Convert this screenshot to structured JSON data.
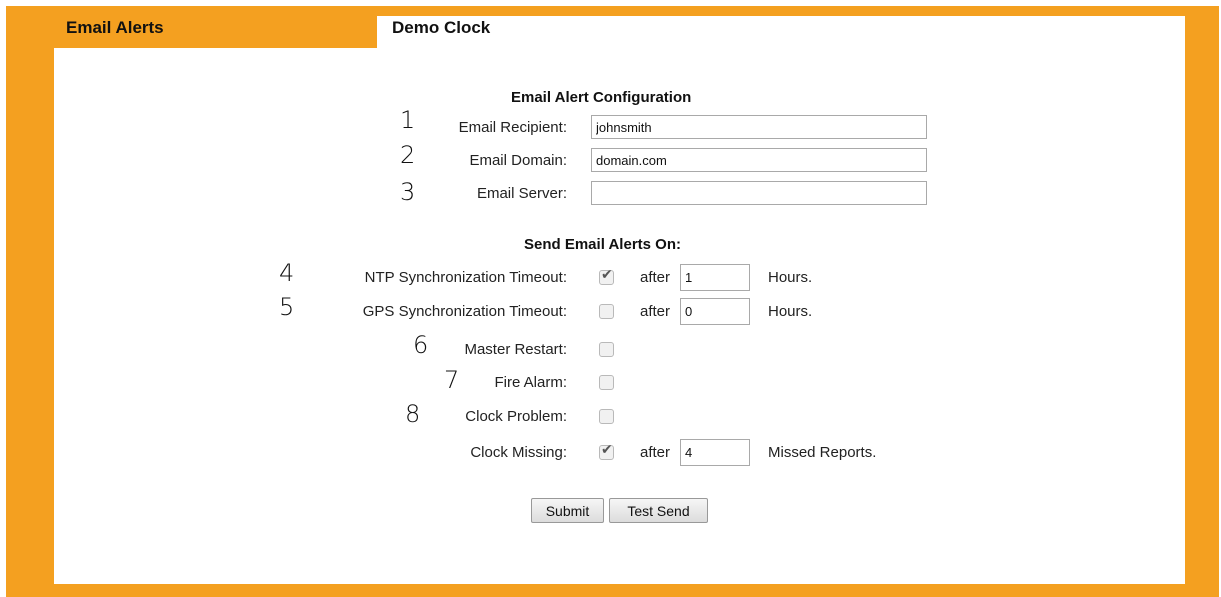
{
  "tabs": {
    "email_alerts": "Email Alerts",
    "demo_clock": "Demo Clock"
  },
  "config": {
    "title": "Email Alert Configuration",
    "fields": [
      {
        "num": "1",
        "label": "Email Recipient:",
        "value": "johnsmith"
      },
      {
        "num": "2",
        "label": "Email Domain:",
        "value": "domain.com"
      },
      {
        "num": "3",
        "label": "Email Server:",
        "value": ""
      }
    ]
  },
  "alerts": {
    "title": "Send Email Alerts On:",
    "after_label": "after",
    "rows": [
      {
        "num": "4",
        "label": "NTP Synchronization Timeout:",
        "checked": true,
        "value": "1",
        "unit": "Hours."
      },
      {
        "num": "5",
        "label": "GPS Synchronization Timeout:",
        "checked": false,
        "value": "0",
        "unit": "Hours."
      },
      {
        "num": "6",
        "label": "Master Restart:",
        "checked": false
      },
      {
        "num": "7",
        "label": "Fire Alarm:",
        "checked": false
      },
      {
        "num": "8",
        "label": "Clock Problem:",
        "checked": false
      },
      {
        "num": "",
        "label": "Clock Missing:",
        "checked": true,
        "value": "4",
        "unit": "Missed Reports."
      }
    ]
  },
  "buttons": {
    "submit": "Submit",
    "test_send": "Test Send"
  },
  "colors": {
    "frame": "#f4a020",
    "panel": "#ffffff"
  }
}
